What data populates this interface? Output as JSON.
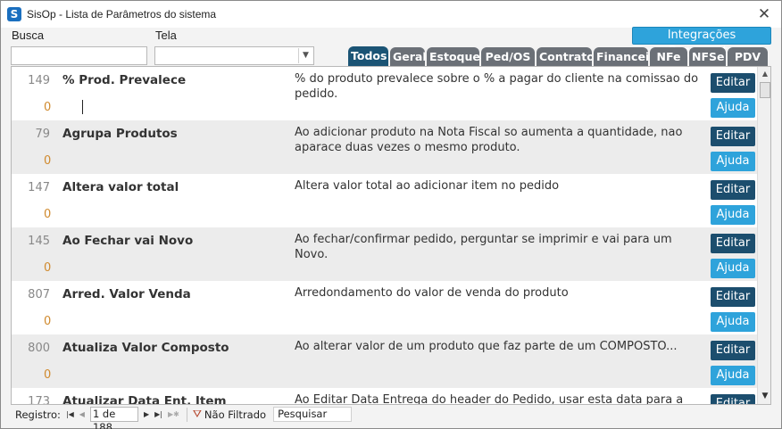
{
  "window": {
    "title": "SisOp - Lista de Parâmetros do sistema",
    "app_icon": "S"
  },
  "filters": {
    "busca_label": "Busca",
    "tela_label": "Tela",
    "busca_value": "",
    "tela_value": ""
  },
  "integ_button": "Integrações Pagamento",
  "tabs": [
    {
      "label": "Todos",
      "active": true,
      "w": 45
    },
    {
      "label": "Geral",
      "active": false,
      "w": 39
    },
    {
      "label": "Estoque",
      "active": false,
      "w": 59
    },
    {
      "label": "Ped/OS",
      "active": false,
      "w": 60
    },
    {
      "label": "Contrato",
      "active": false,
      "w": 62
    },
    {
      "label": "Financeir",
      "active": false,
      "w": 61
    },
    {
      "label": "NFe",
      "active": false,
      "w": 42
    },
    {
      "label": "NFSe",
      "active": false,
      "w": 41
    },
    {
      "label": "PDV",
      "active": false,
      "w": 45
    }
  ],
  "buttons": {
    "editar": "Editar",
    "ajuda": "Ajuda"
  },
  "rows": [
    {
      "id": "149",
      "value": "0",
      "name": "% Prod. Prevalece",
      "desc": "% do produto prevalece sobre o % a pagar do cliente na comissao do pedido."
    },
    {
      "id": "79",
      "value": "0",
      "name": "Agrupa Produtos",
      "desc": "Ao adicionar produto na Nota Fiscal so aumenta a quantidade, nao aparace duas vezes o mesmo produto."
    },
    {
      "id": "147",
      "value": "0",
      "name": "Altera valor total",
      "desc": "Altera valor total ao adicionar item no pedido"
    },
    {
      "id": "145",
      "value": "0",
      "name": "Ao Fechar vai Novo",
      "desc": "Ao fechar/confirmar pedido, perguntar se imprimir e vai para um Novo."
    },
    {
      "id": "807",
      "value": "0",
      "name": "Arred. Valor Venda",
      "desc": "Arredondamento do valor de venda do produto"
    },
    {
      "id": "800",
      "value": "0",
      "name": "Atualiza Valor Composto",
      "desc": "Ao alterar valor de um produto que faz parte de um COMPOSTO..."
    },
    {
      "id": "173",
      "value": "",
      "name": "Atualizar Data Ent. Item",
      "desc": "Ao Editar Data Entrega do header do Pedido, usar esta data para a Data"
    }
  ],
  "navbar": {
    "label": "Registro:",
    "position": "1 de 188",
    "filter": "Não Filtrado",
    "search": "Pesquisar"
  }
}
